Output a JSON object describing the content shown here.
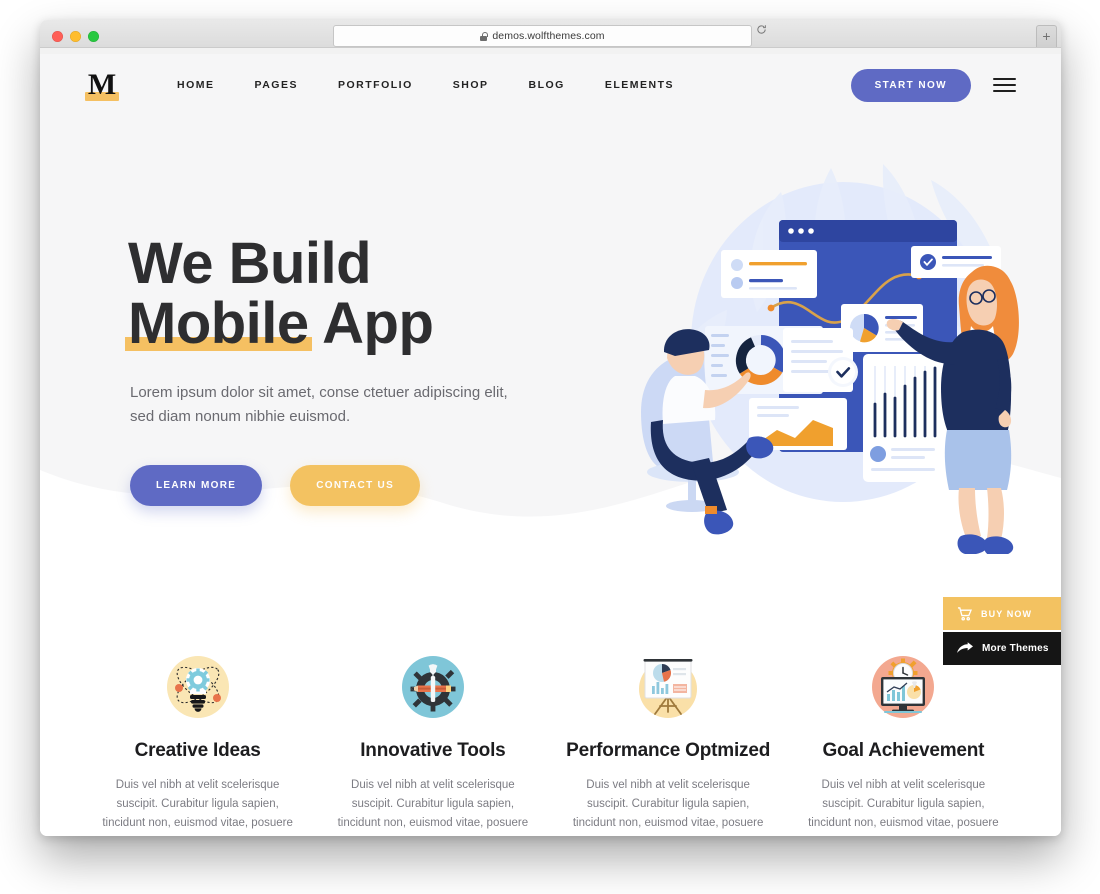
{
  "browser": {
    "url": "demos.wolfthemes.com",
    "lock_icon": "lock-icon",
    "reload_icon": "reload-icon",
    "newtab_label": "+",
    "traffic_lights": [
      "close",
      "minimize",
      "zoom"
    ]
  },
  "nav": {
    "logo_letter": "M",
    "links": [
      {
        "label": "HOME"
      },
      {
        "label": "PAGES"
      },
      {
        "label": "PORTFOLIO"
      },
      {
        "label": "SHOP"
      },
      {
        "label": "BLOG"
      },
      {
        "label": "ELEMENTS"
      }
    ],
    "cta_label": "START NOW",
    "menu_icon": "hamburger-icon"
  },
  "hero": {
    "headline_line1": "We Build",
    "headline_highlight": "Mobile",
    "headline_rest": " App",
    "subtitle": "Lorem ipsum dolor sit amet, conse ctetuer adipiscing elit, sed diam nonum nibhie euismod.",
    "primary_button": "LEARN MORE",
    "secondary_button": "CONTACT US",
    "illustration_name": "team-analytics-dashboard-illustration"
  },
  "side_buttons": {
    "buy": {
      "label": "BUY NOW",
      "icon": "shopping-cart-icon"
    },
    "more": {
      "label": "More Themes",
      "icon": "arrow-share-icon"
    }
  },
  "features": [
    {
      "title": "Creative Ideas",
      "desc": "Duis vel nibh at velit scelerisque suscipit. Curabitur ligula sapien, tincidunt non, euismod vitae, posuere imperdiet, leo.",
      "icon": "lightbulb-atom-gear-icon"
    },
    {
      "title": "Innovative Tools",
      "desc": "Duis vel nibh at velit scelerisque suscipit. Curabitur ligula sapien, tincidunt non, euismod vitae, posuere imperdiet, leo.",
      "icon": "wrench-pencil-gear-icon"
    },
    {
      "title": "Performance Optmized",
      "desc": "Duis vel nibh at velit scelerisque suscipit. Curabitur ligula sapien, tincidunt non, euismod vitae, posuere imperdiet, leo.",
      "icon": "presentation-chart-easel-icon"
    },
    {
      "title": "Goal Achievement",
      "desc": "Duis vel nibh at velit scelerisque suscipit. Curabitur ligula sapien, tincidunt non, euismod vitae, posuere imperdiet, leo.",
      "icon": "monitor-clock-chart-icon"
    }
  ],
  "colors": {
    "accent_purple": "#5f6ac4",
    "accent_amber": "#f3c261",
    "hero_bg": "#f6f6f7",
    "text_dark": "#2e2e30",
    "text_muted": "#7c7c83",
    "black": "#151515"
  }
}
